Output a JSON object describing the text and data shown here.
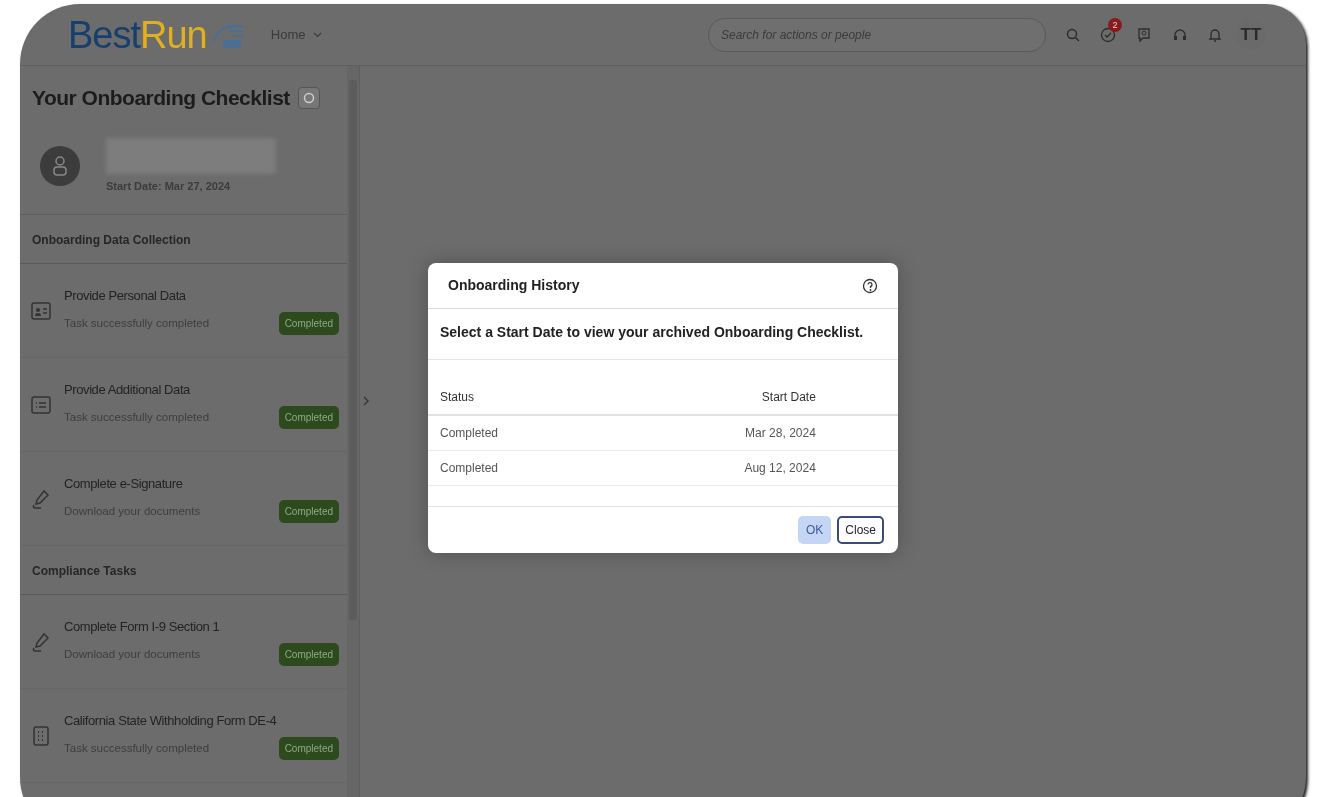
{
  "header": {
    "logo": {
      "part_1": "Best",
      "part_2": "Run"
    },
    "home_menu": "Home",
    "search": {
      "placeholder": "Search for actions or people"
    },
    "notification_count": "2",
    "avatar": "TT"
  },
  "sidebar": {
    "title": "Your Onboarding Checklist",
    "start_date": "Start Date: Mar 27, 2024",
    "sections": [
      {
        "title": "Onboarding Data Collection",
        "tasks": [
          {
            "kind": "profile",
            "title": "Provide Personal Data",
            "subtitle": "Task successfully completed",
            "status": "Completed"
          },
          {
            "kind": "list",
            "title": "Provide Additional Data",
            "subtitle": "Task successfully completed",
            "status": "Completed"
          },
          {
            "kind": "signature",
            "title": "Complete e-Signature",
            "subtitle": "Download your documents",
            "status": "Completed"
          }
        ]
      },
      {
        "title": "Compliance Tasks",
        "tasks": [
          {
            "kind": "signature",
            "title": "Complete Form I-9 Section 1",
            "subtitle": "Download your documents",
            "status": "Completed"
          },
          {
            "kind": "form",
            "title": "California State Withholding Form DE-4",
            "subtitle": "Task successfully completed",
            "status": "Completed"
          }
        ]
      }
    ]
  },
  "dialog": {
    "title": "Onboarding History",
    "instruction": "Select a Start Date to view your archived Onboarding Checklist.",
    "table": {
      "columns": [
        "Status",
        "Start Date"
      ],
      "rows": [
        [
          "Completed",
          "Mar 28, 2024"
        ],
        [
          "Completed",
          "Aug 12, 2024"
        ]
      ]
    },
    "buttons": [
      {
        "label": "OK",
        "disabled": true
      },
      {
        "label": "Close",
        "disabled": false
      }
    ]
  }
}
